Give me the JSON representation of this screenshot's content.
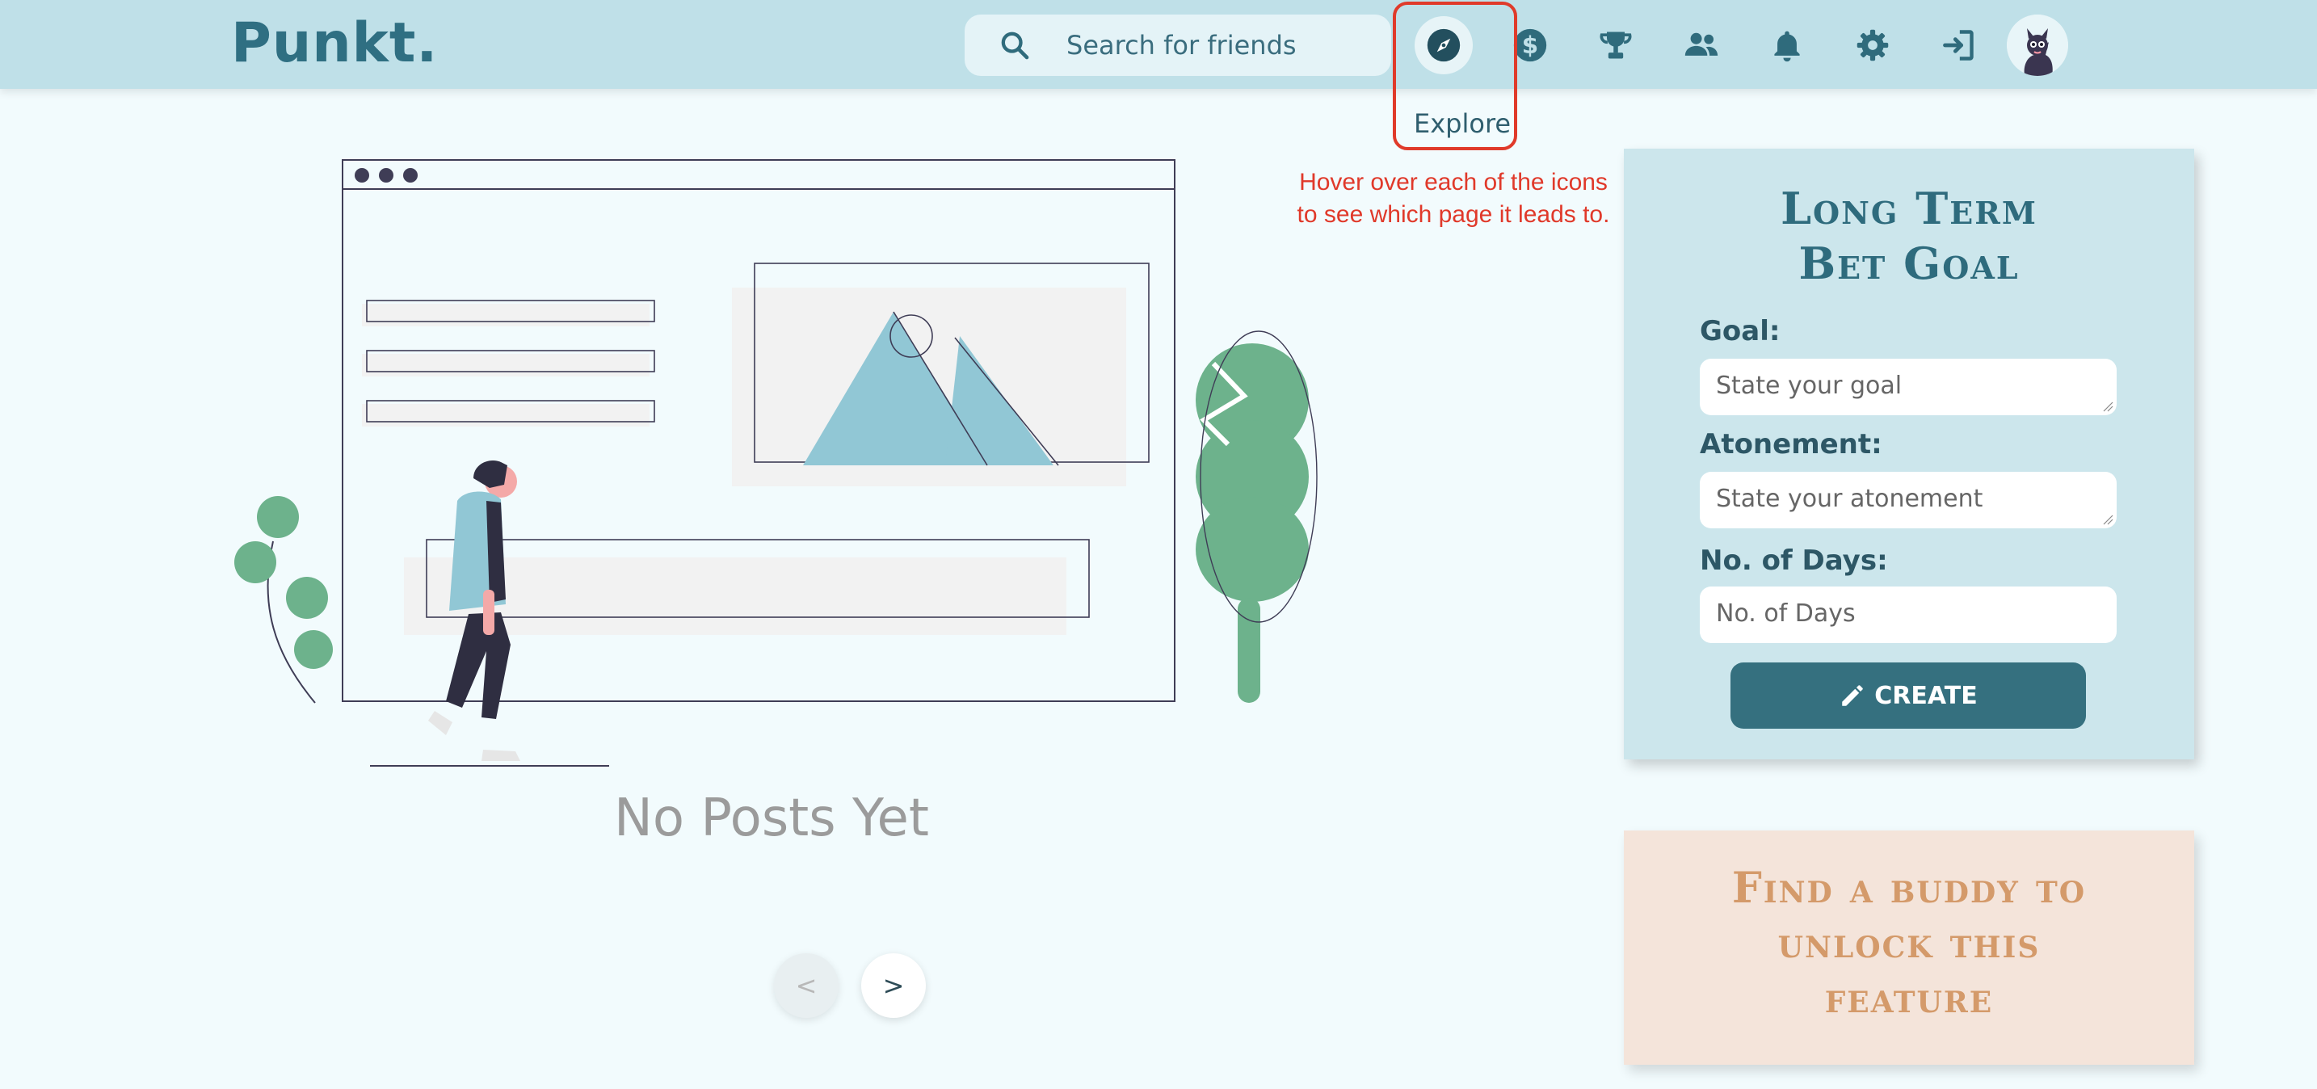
{
  "header": {
    "logo": "Punkt.",
    "search_placeholder": "Search for friends",
    "nav": [
      {
        "name": "explore",
        "icon": "compass-icon"
      },
      {
        "name": "money",
        "icon": "dollar-circle-icon"
      },
      {
        "name": "trophy",
        "icon": "trophy-icon"
      },
      {
        "name": "friends",
        "icon": "users-icon"
      },
      {
        "name": "notifications",
        "icon": "bell-icon"
      },
      {
        "name": "settings",
        "icon": "gear-icon"
      },
      {
        "name": "logout",
        "icon": "sign-out-icon"
      }
    ],
    "tooltip_label": "Explore"
  },
  "annotation": {
    "hint": "Hover over each of the icons to see which page it leads to."
  },
  "main": {
    "empty_text": "No Posts Yet",
    "prev_label": "<",
    "next_label": ">"
  },
  "goal_card": {
    "title_line1": "Long Term",
    "title_line2": "Bet Goal",
    "goal_label": "Goal:",
    "goal_placeholder": "State your goal",
    "atonement_label": "Atonement:",
    "atonement_placeholder": "State your atonement",
    "days_label": "No. of Days:",
    "days_placeholder": "No. of Days",
    "create_label": "CREATE"
  },
  "buddy_card": {
    "line1": "Find a buddy to",
    "line2": "unlock this",
    "line3": "feature"
  },
  "colors": {
    "header_bg": "#bfe0e8",
    "accent": "#35707f",
    "annotation": "#e03a2a",
    "buddy_text": "#d49a6a"
  }
}
